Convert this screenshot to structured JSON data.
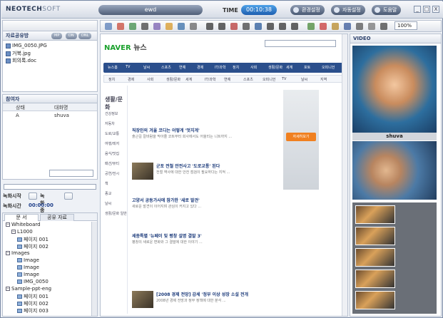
{
  "header": {
    "logo_main": "NEOTECH",
    "logo_soft": "SOFT",
    "title_tab": "ewd",
    "time_label": "TIME",
    "time_value": "00:10:38",
    "buttons": [
      "환경설정",
      "자동설정",
      "도움말"
    ],
    "window_controls": [
      "_",
      "□",
      "X"
    ]
  },
  "left_panel": {
    "files_title": "자료공유방",
    "pills": [
      "MP",
      "DN",
      "DNL"
    ],
    "files": [
      "IMG_0050.JPG",
      "거북.jpg",
      "회의록.doc"
    ],
    "users_title": "참여자",
    "users_cols": [
      "상태",
      "대화명"
    ],
    "users": [
      {
        "status": "A",
        "name": "shuva"
      }
    ],
    "record_start_label": "녹화시작",
    "record_stop_label": "녹화종료",
    "record_time_label": "녹화시간",
    "record_time_value": "00:00:00",
    "doc_tabs": [
      "문 서",
      "공유 자료"
    ],
    "tree": [
      {
        "label": "Whiteboard",
        "level": 0
      },
      {
        "label": "L1000",
        "level": 1
      },
      {
        "label": "페이지 001",
        "level": 2
      },
      {
        "label": "페이지 002",
        "level": 2
      },
      {
        "label": "Images",
        "level": 0
      },
      {
        "label": "Image",
        "level": 2
      },
      {
        "label": "Image",
        "level": 2
      },
      {
        "label": "Image",
        "level": 2
      },
      {
        "label": "IMG_0050",
        "level": 2
      },
      {
        "label": "Sample-ppt-eng",
        "level": 0
      },
      {
        "label": "페이지 001",
        "level": 2
      },
      {
        "label": "페이지 002",
        "level": 2
      },
      {
        "label": "페이지 003",
        "level": 2
      }
    ]
  },
  "toolbar": {
    "zoom": "100%"
  },
  "browser": {
    "naver_logo": "NAVER",
    "naver_section": "뉴스",
    "nav_items": [
      "뉴스홈",
      "TV",
      "날씨",
      "스포츠",
      "연예",
      "경제",
      "IT/과학",
      "정치",
      "사회",
      "생활/문화",
      "세계",
      "포토",
      "오피니언"
    ],
    "sub_items": [
      "정치",
      "경제",
      "사회",
      "생활/문화",
      "세계",
      "IT/과학",
      "연예",
      "스포츠",
      "오피니언",
      "TV",
      "날씨",
      "지역"
    ],
    "left_nav_title": "생활/문화",
    "left_nav_items": [
      "건강정보",
      "자동차",
      "도로/교통",
      "여행/레저",
      "음식/맛집",
      "패션/뷰티",
      "공연/전시",
      "책",
      "종교",
      "날씨",
      "생활/문화 일반"
    ],
    "articles": [
      {
        "title": "직장인의 겨울 코디는 어떻게 '멋지게'",
        "body": "출근길 칼바람을 막아줄 코트부터 회사에서도 어울리는 니트까지 ..."
      },
      {
        "title": "군포 전철 안전사고 '도로교통' 된다",
        "body": "전철 역사에 대한 안전 점검이 필요하다는 지적 ..."
      },
      {
        "title": "고양서 공동가사에 참가한 '새로 발견'",
        "body": "새로운 발견이 이어지며 관심이 커지고 있다 ..."
      },
      {
        "title": "세종특별 '뉴페이 및 평창 설명 결말 3'",
        "body": "평창의 새로운 변화와 그 결말에 대한 이야기 ..."
      },
      {
        "title": "[2008 경제 전망] 감세 '정부 이상 성장 소설 전개",
        "body": "2008년 경제 전망과 정부 정책에 대한 분석 ..."
      }
    ],
    "ad_button": "자세히보기"
  },
  "video": {
    "title": "VIDEO",
    "name": "shuva"
  }
}
